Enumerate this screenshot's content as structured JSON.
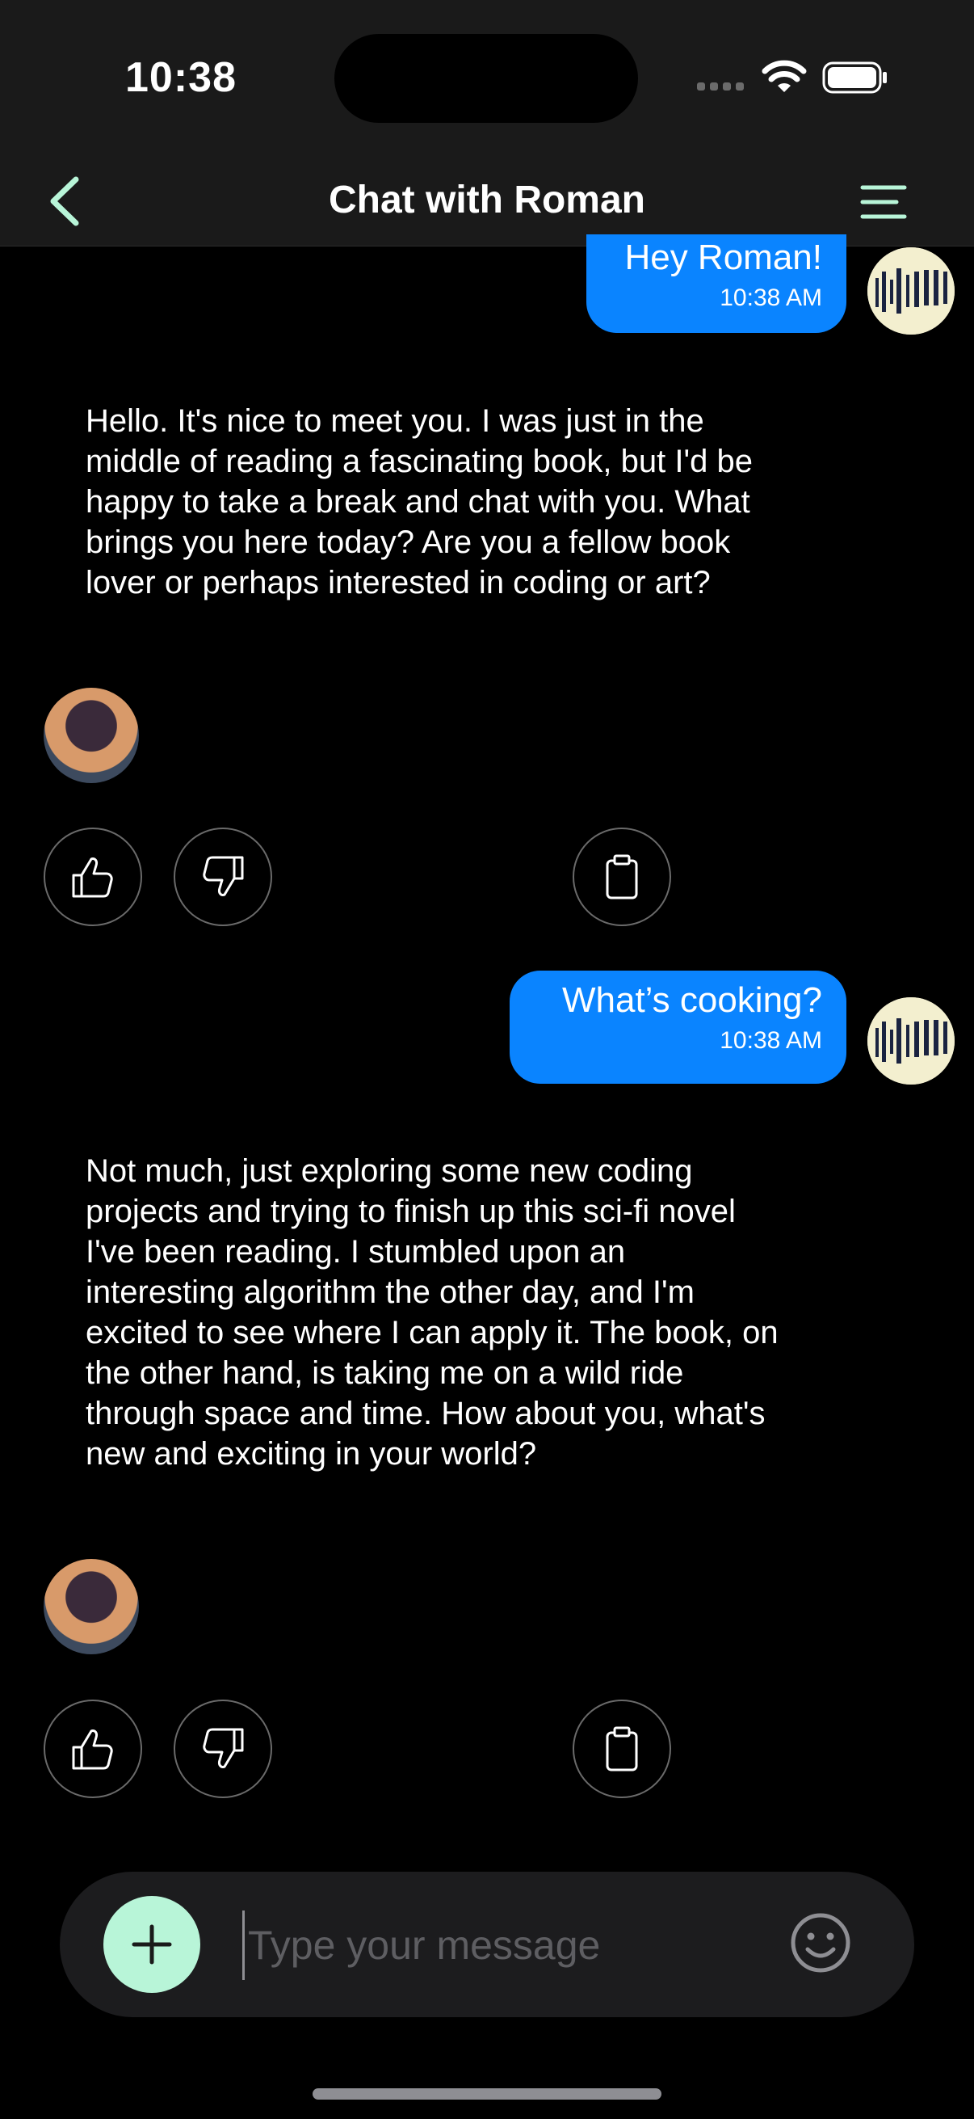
{
  "status_bar": {
    "time": "10:38"
  },
  "nav": {
    "title": "Chat with Roman"
  },
  "messages": [
    {
      "from": "user",
      "text": "Hey Roman!",
      "time": "10:38 AM"
    },
    {
      "from": "bot",
      "text": "Hello. It's nice to meet you. I was just in the middle of reading a fascinating book, but I'd be happy to take a break and chat with you. What brings you here today? Are you a fellow book lover or perhaps interested in coding or art?"
    },
    {
      "from": "user",
      "text": "What’s cooking?",
      "time": "10:38 AM"
    },
    {
      "from": "bot",
      "text": "Not much, just exploring some new coding projects and trying to finish up this sci-fi novel I've been reading. I stumbled upon an interesting algorithm the other day, and I'm excited to see where I can apply it. The book, on the other hand, is taking me on a wild ride through space and time. How about you, what's new and exciting in your world?"
    }
  ],
  "composer": {
    "placeholder": "Type your message"
  },
  "colors": {
    "accent": "#b8f5d8",
    "bubble": "#0a84ff",
    "bar": "#1a1a1a"
  },
  "icons": [
    "chevron-left-icon",
    "menu-icon",
    "thumbs-up-icon",
    "thumbs-down-icon",
    "clipboard-icon",
    "plus-icon",
    "smiley-icon"
  ]
}
